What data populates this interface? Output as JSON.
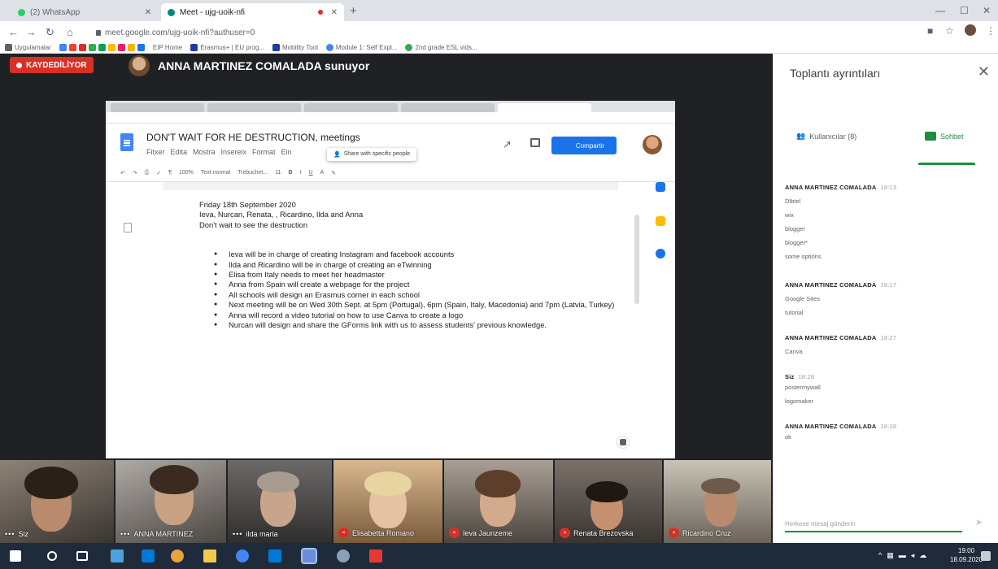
{
  "browser": {
    "tabs": [
      {
        "label": "(2) WhatsApp",
        "color": "#25d366"
      },
      {
        "label": "Meet - ujg-uoik-nfi",
        "color": "#00897b"
      }
    ],
    "url": "meet.google.com/ujg-uoik-nfi?authuser=0",
    "bookmarks": [
      "Uygulamalar",
      "EIP Home",
      "Erasmus+ | EU prog...",
      "Mobility Tool",
      "Module 1: Self Expl...",
      "2nd grade ESL vids..."
    ]
  },
  "meet": {
    "recording_label": "KAYDEDİLİYOR",
    "presenter_label": "ANNA MARTINEZ COMALADA sunuyor"
  },
  "doc": {
    "title": "DON'T WAIT FOR HE DESTRUCTION, meetings",
    "menu": [
      "Fitxer",
      "Edita",
      "Mostra",
      "Insereix",
      "Format",
      "Ein"
    ],
    "share_tooltip": "Share with specific people",
    "share_button": "Compartir",
    "toolbar": [
      "100%",
      "Text normal",
      "Trebuchet...",
      "11",
      "B",
      "I",
      "U",
      "A"
    ],
    "lines": [
      "Friday 18th September 2020",
      "Ieva, Nurcan, Renata, , Ricardino, Ilda and Anna",
      "Don't wait to see the destruction"
    ],
    "bullets": [
      "Ieva will be in charge of creating Instagram and facebook accounts",
      "Ilda and Ricardino will be in charge of creating an eTwinning",
      "Elisa from Italy needs to meet her headmaster",
      "Anna from Spain will create a webpage for the project",
      "All schools will design an Erasmus corner in each school",
      "Next meeting will be on Wed 30th Sept. at 5pm (Portugal), 6pm (Spain, Italy, Macedonia) and 7pm (Latvia, Turkey)",
      "Anna will record a video tutorial on how to use Canva to create a logo",
      "Nurcan will design and share the GForms link with us to assess students' previous knowledge."
    ]
  },
  "participants": [
    {
      "name": "Siz",
      "muted": false
    },
    {
      "name": "ANNA MARTINEZ",
      "muted": false
    },
    {
      "name": "ilda maria",
      "muted": false
    },
    {
      "name": "Elisabetta Romano",
      "muted": true
    },
    {
      "name": "Ieva Jaunzeme",
      "muted": true
    },
    {
      "name": "Renata Brezovska",
      "muted": true
    },
    {
      "name": "Ricardino Cruz",
      "muted": true
    }
  ],
  "panel": {
    "title": "Toplantı ayrıntıları",
    "tab_people": "Kullanıcılar (8)",
    "tab_chat": "Sohbet",
    "input_placeholder": "Herkese mesaj gönderin",
    "messages": [
      {
        "sender": "ANNA MARTINEZ COMALADA",
        "time": "18:13",
        "lines": [
          "Dlbtel",
          "wix",
          "blogger",
          "blogger*",
          "some options"
        ]
      },
      {
        "sender": "ANNA MARTINEZ COMALADA",
        "time": "18:17",
        "lines": [
          "Google Sites",
          "tutorial"
        ]
      },
      {
        "sender": "ANNA MARTINEZ COMALADA",
        "time": "18:27",
        "lines": [
          "Canva"
        ]
      },
      {
        "sender": "Siz",
        "time": "18:28",
        "lines": [
          "postermywall",
          "logomaker"
        ]
      },
      {
        "sender": "ANNA MARTINEZ COMALADA",
        "time": "18:28",
        "lines": [
          "ok"
        ]
      }
    ]
  },
  "taskbar": {
    "time": "19:00",
    "date": "18.09.2020"
  }
}
